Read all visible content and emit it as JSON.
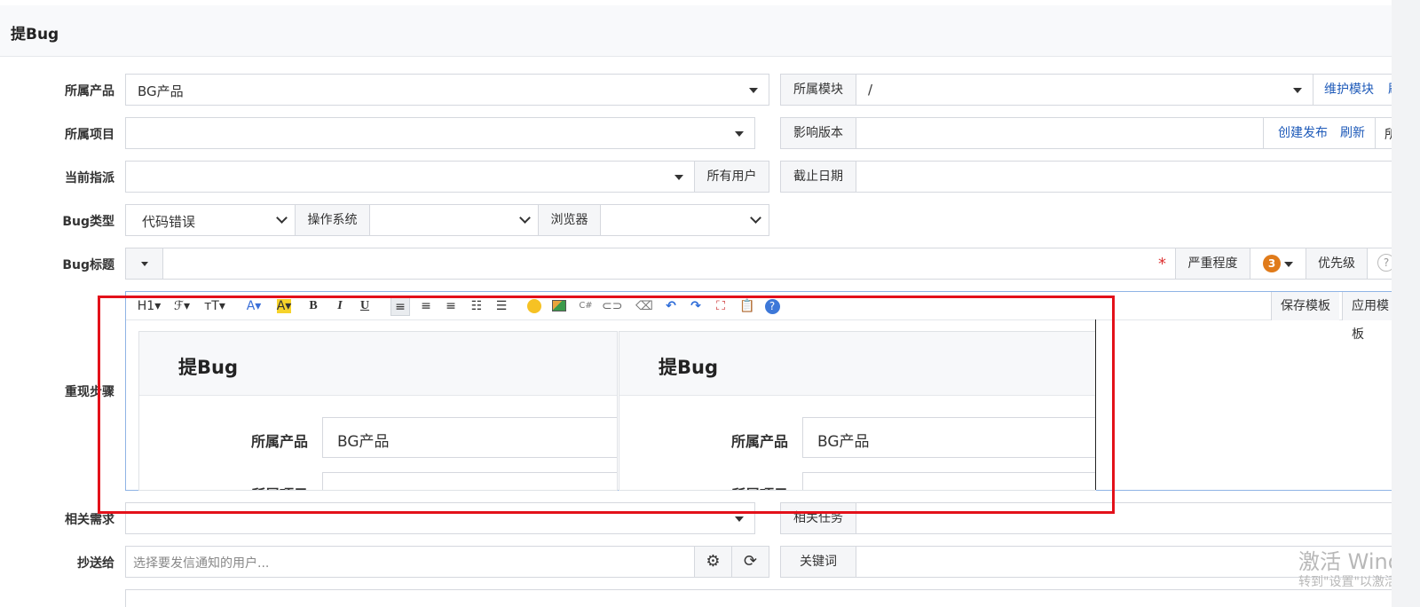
{
  "header": {
    "title": "提Bug"
  },
  "form": {
    "product": {
      "label": "所属产品",
      "value": "BG产品"
    },
    "module": {
      "label": "所属模块",
      "value": "/",
      "maintain": "维护模块",
      "refresh_cut": "刷"
    },
    "project": {
      "label": "所属项目",
      "value": ""
    },
    "version": {
      "label": "影响版本",
      "create_release": "创建发布",
      "refresh": "刷新",
      "extra_cut": "所"
    },
    "assign": {
      "label": "当前指派",
      "value": "",
      "all_users": "所有用户"
    },
    "deadline": {
      "label": "截止日期",
      "value": ""
    },
    "bug_type": {
      "label": "Bug类型",
      "value": "代码错误",
      "os_label": "操作系统",
      "os_value": "",
      "browser_label": "浏览器",
      "browser_value": ""
    },
    "title": {
      "label": "Bug标题",
      "value": "",
      "required_mark": "*",
      "severity_label": "严重程度",
      "severity_value": "3",
      "priority_label": "优先级",
      "help_cut": "?"
    },
    "steps": {
      "label": "重现步骤",
      "toolbar": {
        "h1": "H1▾",
        "font": "ℱ▾",
        "size": "ᴛT▾",
        "font_color": "A▾",
        "bg_color": "A▾",
        "bold": "B",
        "italic": "I",
        "underline": "U",
        "save_template": "保存模板",
        "apply_template": "应用模板"
      },
      "preview": [
        {
          "title": "提Bug",
          "field_label": "所属产品",
          "field_value": "BG产品",
          "field2_label": "所属项目"
        },
        {
          "title": "提Bug",
          "field_label": "所属产品",
          "field_value": "BG产品",
          "field2_label": "所属项目"
        }
      ]
    },
    "story": {
      "label": "相关需求",
      "value": ""
    },
    "task": {
      "label": "相关任务",
      "value": ""
    },
    "cc": {
      "label": "抄送给",
      "placeholder": "选择要发信通知的用户..."
    },
    "keywords": {
      "label": "关键词",
      "value": ""
    }
  },
  "watermark": {
    "line1": "激活 Windows",
    "line2": "转到\"设置\"以激活 Windows。"
  },
  "colors": {
    "accent": "#1e5ab9",
    "highlight_border": "#e3111a",
    "badge": "#e07b1a"
  }
}
